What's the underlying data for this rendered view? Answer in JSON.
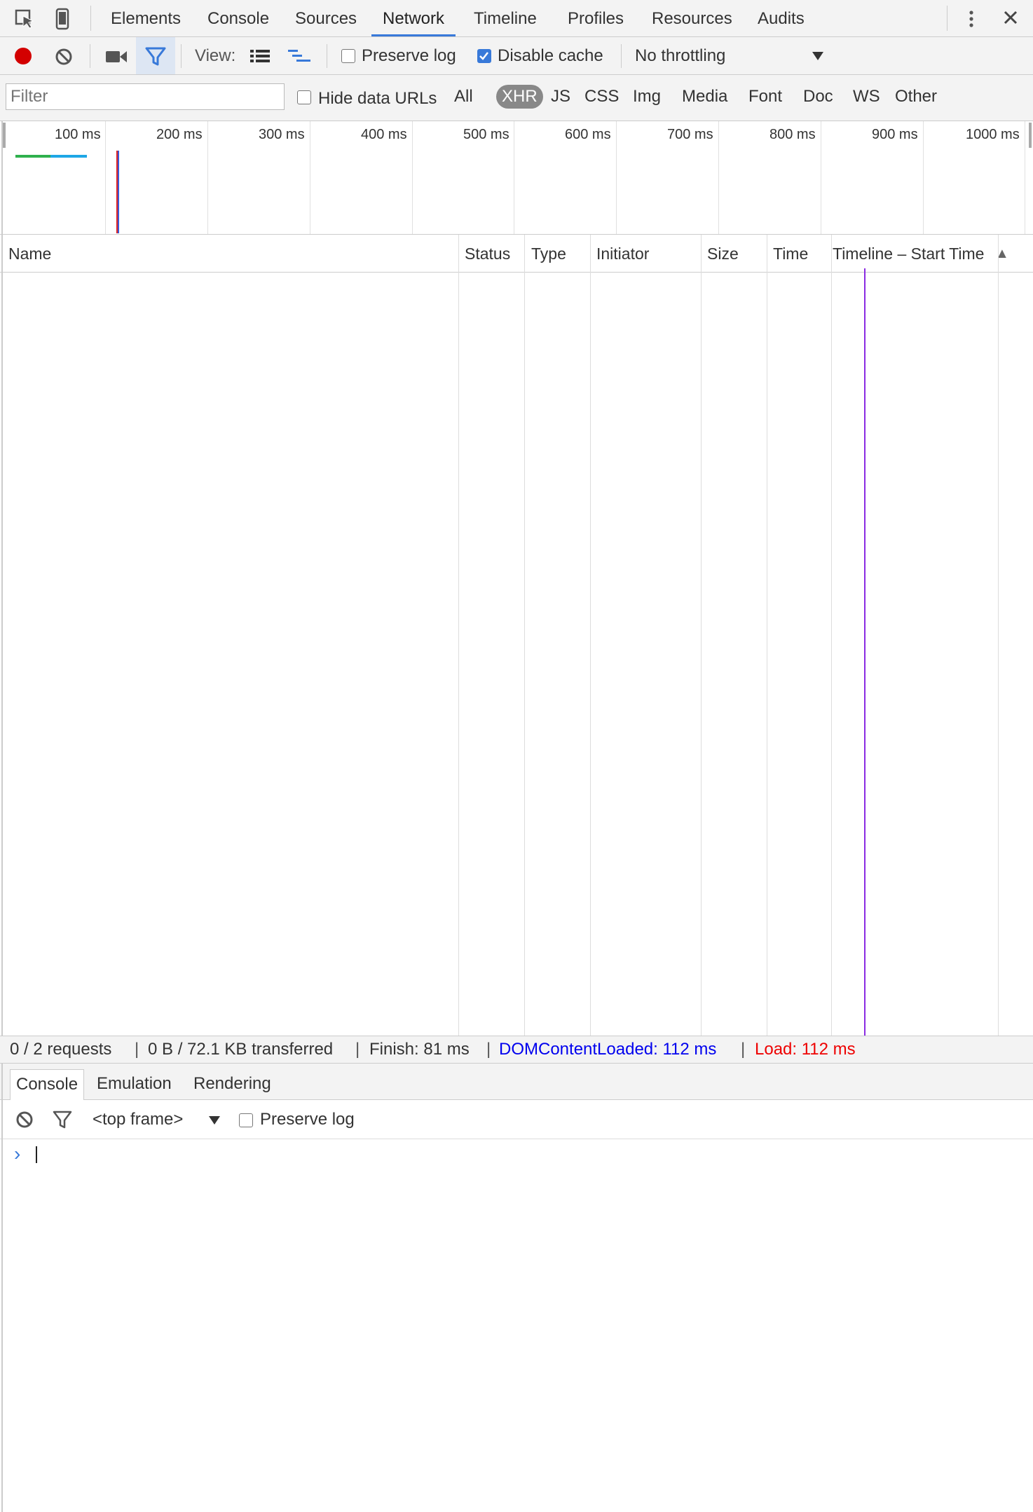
{
  "tabs": [
    {
      "label": "Elements"
    },
    {
      "label": "Console"
    },
    {
      "label": "Sources"
    },
    {
      "label": "Network"
    },
    {
      "label": "Timeline"
    },
    {
      "label": "Profiles"
    },
    {
      "label": "Resources"
    },
    {
      "label": "Audits"
    }
  ],
  "active_tab": "Network",
  "toolbar": {
    "view_label": "View:",
    "preserve_log_label": "Preserve log",
    "preserve_log_checked": false,
    "disable_cache_label": "Disable cache",
    "disable_cache_checked": true,
    "throttling_value": "No throttling"
  },
  "filter": {
    "placeholder": "Filter",
    "hide_data_urls_label": "Hide data URLs",
    "types": [
      "All",
      "XHR",
      "JS",
      "CSS",
      "Img",
      "Media",
      "Font",
      "Doc",
      "WS",
      "Other"
    ],
    "selected_type": "XHR"
  },
  "overview": {
    "ticks": [
      "100 ms",
      "200 ms",
      "300 ms",
      "400 ms",
      "500 ms",
      "600 ms",
      "700 ms",
      "800 ms",
      "900 ms",
      "1000 ms"
    ]
  },
  "table": {
    "columns": [
      "Name",
      "Status",
      "Type",
      "Initiator",
      "Size",
      "Time",
      "Timeline – Start Time"
    ],
    "sort_indicator": "▲",
    "rows": []
  },
  "status": {
    "requests": "0 / 2 requests",
    "transferred": "0 B / 72.1 KB transferred",
    "finish": "Finish: 81 ms",
    "dom_content_loaded": "DOMContentLoaded: 112 ms",
    "load": "Load: 112 ms"
  },
  "drawer": {
    "tabs": [
      "Console",
      "Emulation",
      "Rendering"
    ],
    "active_tab": "Console",
    "context_value": "<top frame>",
    "preserve_log_label": "Preserve log",
    "prompt_symbol": "›"
  },
  "colors": {
    "accent": "#3879d9",
    "record": "#d30000",
    "dom_content_loaded": "#0000ee",
    "load": "#ee0000",
    "timeline_marker": "#8a2be2"
  }
}
